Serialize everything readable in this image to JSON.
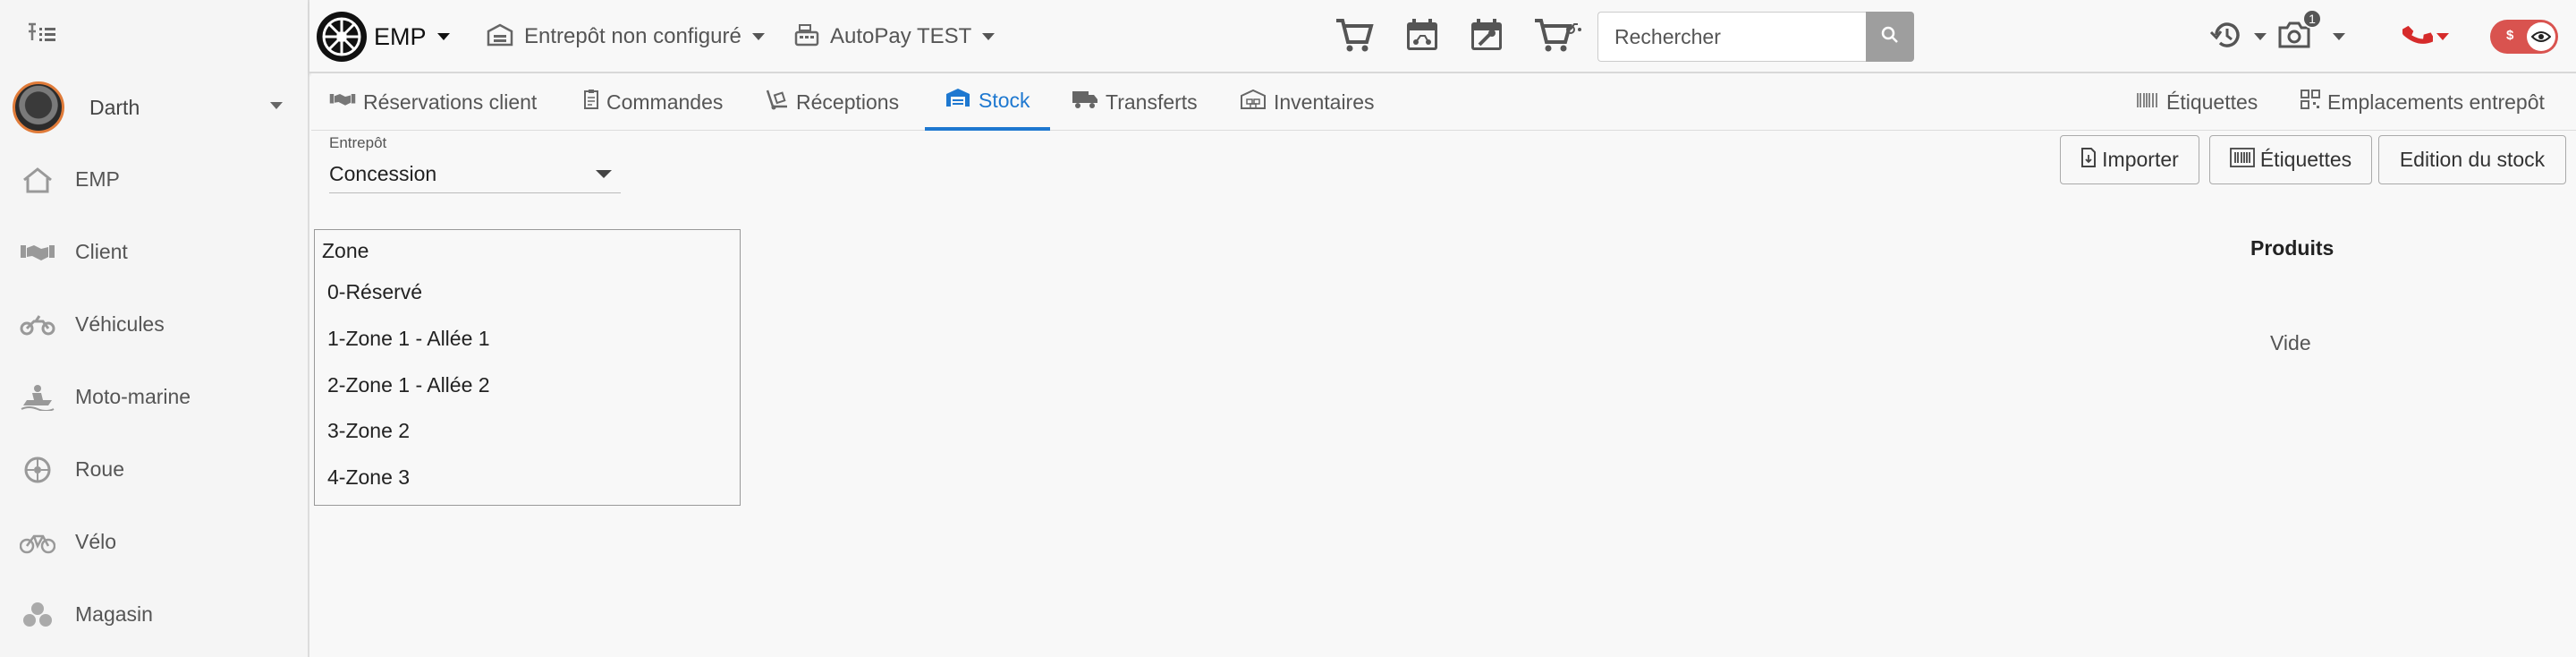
{
  "sidebar": {
    "pin_icon": "pin-list-icon",
    "user": {
      "name": "Darth"
    },
    "items": [
      {
        "label": "EMP",
        "icon": "home-icon"
      },
      {
        "label": "Client",
        "icon": "handshake-icon"
      },
      {
        "label": "Véhicules",
        "icon": "motorcycle-icon"
      },
      {
        "label": "Moto-marine",
        "icon": "jetski-icon"
      },
      {
        "label": "Roue",
        "icon": "wheel-icon"
      },
      {
        "label": "Vélo",
        "icon": "bicycle-icon"
      },
      {
        "label": "Magasin",
        "icon": "boxes-icon"
      }
    ]
  },
  "topbar": {
    "brand": "EMP",
    "warehouse": "Entrepôt non configuré",
    "payment": "AutoPay TEST",
    "search_placeholder": "Rechercher",
    "badge_count": "1"
  },
  "tabs": [
    {
      "label": "Réservations client",
      "active": false
    },
    {
      "label": "Commandes",
      "active": false
    },
    {
      "label": "Réceptions",
      "active": false
    },
    {
      "label": "Stock",
      "active": true
    },
    {
      "label": "Transferts",
      "active": false
    },
    {
      "label": "Inventaires",
      "active": false
    },
    {
      "label": "Étiquettes",
      "active": false
    },
    {
      "label": "Emplacements entrepôt",
      "active": false
    }
  ],
  "content": {
    "warehouse_field": {
      "label": "Entrepôt",
      "value": "Concession"
    },
    "buttons": {
      "import": "Importer",
      "labels": "Étiquettes",
      "edit": "Edition du stock"
    },
    "zones": {
      "title": "Zone",
      "items": [
        "0-Réservé",
        "1-Zone 1 - Allée 1",
        "2-Zone 1 - Allée 2",
        "3-Zone 2",
        "4-Zone 3"
      ]
    },
    "products": {
      "title": "Produits",
      "empty": "Vide"
    }
  },
  "colors": {
    "accent": "#1e78d0",
    "danger": "#d9534f",
    "phone": "#d62b2b"
  }
}
